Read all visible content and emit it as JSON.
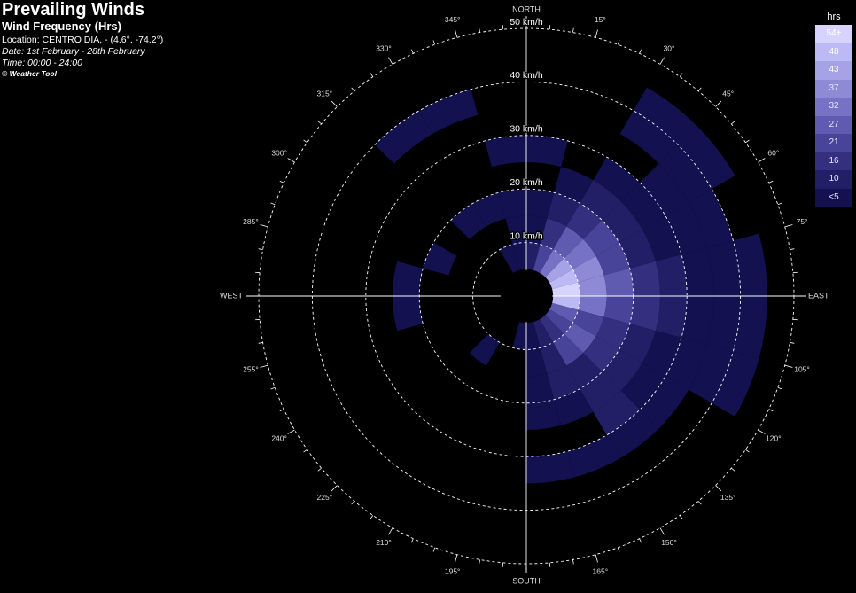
{
  "header": {
    "title": "Prevailing Winds",
    "subtitle": "Wind Frequency (Hrs)",
    "location": "Location: CENTRO DIA, - (4.6°, -74.2°)",
    "date": "Date: 1st February - 28th February",
    "time": "Time: 00:00 - 24:00",
    "copyright": "© Weather Tool"
  },
  "legend": {
    "title": "hrs",
    "items": [
      {
        "label": "54+",
        "color": "#d6d4ff"
      },
      {
        "label": "48",
        "color": "#bcb9f4"
      },
      {
        "label": "43",
        "color": "#a5a2e6"
      },
      {
        "label": "37",
        "color": "#8e8ad6"
      },
      {
        "label": "32",
        "color": "#7672c6"
      },
      {
        "label": "27",
        "color": "#5f5bb1"
      },
      {
        "label": "21",
        "color": "#48449a"
      },
      {
        "label": "16",
        "color": "#34307f"
      },
      {
        "label": "10",
        "color": "#221f66"
      },
      {
        "label": "<5",
        "color": "#131150"
      }
    ]
  },
  "chart_data": {
    "type": "polar_heatmap",
    "title": "Prevailing Winds",
    "subtitle": "Wind Frequency (Hrs)",
    "units": "km/h",
    "max_speed": 50,
    "rings": [
      {
        "value": 10,
        "label": "10 km/h"
      },
      {
        "value": 20,
        "label": "20 km/h"
      },
      {
        "value": 30,
        "label": "30 km/h"
      },
      {
        "value": 40,
        "label": "40 km/h"
      },
      {
        "value": 50,
        "label": "50 km/h"
      }
    ],
    "compass": [
      {
        "angle": 0,
        "label": "NORTH"
      },
      {
        "angle": 90,
        "label": "EAST"
      },
      {
        "angle": 180,
        "label": "SOUTH"
      },
      {
        "angle": 270,
        "label": "WEST"
      }
    ],
    "angle_labels": [
      {
        "angle": 15,
        "label": "15°"
      },
      {
        "angle": 30,
        "label": "30°"
      },
      {
        "angle": 45,
        "label": "45°"
      },
      {
        "angle": 60,
        "label": "60°"
      },
      {
        "angle": 75,
        "label": "75°"
      },
      {
        "angle": 105,
        "label": "105°"
      },
      {
        "angle": 120,
        "label": "120°"
      },
      {
        "angle": 135,
        "label": "135°"
      },
      {
        "angle": 150,
        "label": "150°"
      },
      {
        "angle": 165,
        "label": "165°"
      },
      {
        "angle": 195,
        "label": "195°"
      },
      {
        "angle": 210,
        "label": "210°"
      },
      {
        "angle": 225,
        "label": "225°"
      },
      {
        "angle": 240,
        "label": "240°"
      },
      {
        "angle": 255,
        "label": "255°"
      },
      {
        "angle": 285,
        "label": "285°"
      },
      {
        "angle": 300,
        "label": "300°"
      },
      {
        "angle": 315,
        "label": "315°"
      },
      {
        "angle": 330,
        "label": "330°"
      },
      {
        "angle": 345,
        "label": "345°"
      }
    ],
    "cells": [
      {
        "dir_from": 0,
        "dir_to": 15,
        "speed_from": 5,
        "speed_to": 10,
        "hours": 10
      },
      {
        "dir_from": 0,
        "dir_to": 15,
        "speed_from": 10,
        "speed_to": 15,
        "hours": 6
      },
      {
        "dir_from": 0,
        "dir_to": 15,
        "speed_from": 15,
        "speed_to": 20,
        "hours": 4
      },
      {
        "dir_from": 0,
        "dir_to": 15,
        "speed_from": 25,
        "speed_to": 30,
        "hours": 4
      },
      {
        "dir_from": 345,
        "dir_to": 360,
        "speed_from": 5,
        "speed_to": 10,
        "hours": 6
      },
      {
        "dir_from": 345,
        "dir_to": 360,
        "speed_from": 10,
        "speed_to": 15,
        "hours": 5
      },
      {
        "dir_from": 345,
        "dir_to": 360,
        "speed_from": 15,
        "speed_to": 20,
        "hours": 4
      },
      {
        "dir_from": 345,
        "dir_to": 360,
        "speed_from": 25,
        "speed_to": 30,
        "hours": 4
      },
      {
        "dir_from": 330,
        "dir_to": 345,
        "speed_from": 5,
        "speed_to": 10,
        "hours": 4
      },
      {
        "dir_from": 330,
        "dir_to": 345,
        "speed_from": 15,
        "speed_to": 20,
        "hours": 4
      },
      {
        "dir_from": 330,
        "dir_to": 345,
        "speed_from": 35,
        "speed_to": 40,
        "hours": 3
      },
      {
        "dir_from": 315,
        "dir_to": 330,
        "speed_from": 15,
        "speed_to": 20,
        "hours": 4
      },
      {
        "dir_from": 315,
        "dir_to": 330,
        "speed_from": 35,
        "speed_to": 40,
        "hours": 3
      },
      {
        "dir_from": 15,
        "dir_to": 30,
        "speed_from": 5,
        "speed_to": 10,
        "hours": 24
      },
      {
        "dir_from": 15,
        "dir_to": 30,
        "speed_from": 10,
        "speed_to": 15,
        "hours": 16
      },
      {
        "dir_from": 15,
        "dir_to": 30,
        "speed_from": 15,
        "speed_to": 20,
        "hours": 10
      },
      {
        "dir_from": 15,
        "dir_to": 30,
        "speed_from": 20,
        "speed_to": 25,
        "hours": 6
      },
      {
        "dir_from": 30,
        "dir_to": 45,
        "speed_from": 5,
        "speed_to": 10,
        "hours": 36
      },
      {
        "dir_from": 30,
        "dir_to": 45,
        "speed_from": 10,
        "speed_to": 15,
        "hours": 30
      },
      {
        "dir_from": 30,
        "dir_to": 45,
        "speed_from": 15,
        "speed_to": 20,
        "hours": 20
      },
      {
        "dir_from": 30,
        "dir_to": 45,
        "speed_from": 20,
        "speed_to": 25,
        "hours": 10
      },
      {
        "dir_from": 30,
        "dir_to": 45,
        "speed_from": 25,
        "speed_to": 30,
        "hours": 4
      },
      {
        "dir_from": 30,
        "dir_to": 45,
        "speed_from": 35,
        "speed_to": 40,
        "hours": 3
      },
      {
        "dir_from": 30,
        "dir_to": 45,
        "speed_from": 40,
        "speed_to": 45,
        "hours": 3
      },
      {
        "dir_from": 45,
        "dir_to": 60,
        "speed_from": 5,
        "speed_to": 10,
        "hours": 44
      },
      {
        "dir_from": 45,
        "dir_to": 60,
        "speed_from": 10,
        "speed_to": 15,
        "hours": 34
      },
      {
        "dir_from": 45,
        "dir_to": 60,
        "speed_from": 15,
        "speed_to": 20,
        "hours": 24
      },
      {
        "dir_from": 45,
        "dir_to": 60,
        "speed_from": 20,
        "speed_to": 25,
        "hours": 14
      },
      {
        "dir_from": 45,
        "dir_to": 60,
        "speed_from": 25,
        "speed_to": 30,
        "hours": 8
      },
      {
        "dir_from": 45,
        "dir_to": 60,
        "speed_from": 30,
        "speed_to": 35,
        "hours": 5
      },
      {
        "dir_from": 45,
        "dir_to": 60,
        "speed_from": 35,
        "speed_to": 40,
        "hours": 3
      },
      {
        "dir_from": 45,
        "dir_to": 60,
        "speed_from": 40,
        "speed_to": 45,
        "hours": 3
      },
      {
        "dir_from": 60,
        "dir_to": 75,
        "speed_from": 5,
        "speed_to": 10,
        "hours": 50
      },
      {
        "dir_from": 60,
        "dir_to": 75,
        "speed_from": 10,
        "speed_to": 15,
        "hours": 38
      },
      {
        "dir_from": 60,
        "dir_to": 75,
        "speed_from": 15,
        "speed_to": 20,
        "hours": 26
      },
      {
        "dir_from": 60,
        "dir_to": 75,
        "speed_from": 20,
        "speed_to": 25,
        "hours": 14
      },
      {
        "dir_from": 60,
        "dir_to": 75,
        "speed_from": 25,
        "speed_to": 30,
        "hours": 8
      },
      {
        "dir_from": 60,
        "dir_to": 75,
        "speed_from": 30,
        "speed_to": 35,
        "hours": 5
      },
      {
        "dir_from": 60,
        "dir_to": 75,
        "speed_from": 35,
        "speed_to": 40,
        "hours": 4
      },
      {
        "dir_from": 75,
        "dir_to": 90,
        "speed_from": 5,
        "speed_to": 10,
        "hours": 56
      },
      {
        "dir_from": 75,
        "dir_to": 90,
        "speed_from": 10,
        "speed_to": 15,
        "hours": 40
      },
      {
        "dir_from": 75,
        "dir_to": 90,
        "speed_from": 15,
        "speed_to": 20,
        "hours": 28
      },
      {
        "dir_from": 75,
        "dir_to": 90,
        "speed_from": 20,
        "speed_to": 25,
        "hours": 18
      },
      {
        "dir_from": 75,
        "dir_to": 90,
        "speed_from": 25,
        "speed_to": 30,
        "hours": 10
      },
      {
        "dir_from": 75,
        "dir_to": 90,
        "speed_from": 30,
        "speed_to": 35,
        "hours": 6
      },
      {
        "dir_from": 75,
        "dir_to": 90,
        "speed_from": 35,
        "speed_to": 40,
        "hours": 4
      },
      {
        "dir_from": 75,
        "dir_to": 90,
        "speed_from": 40,
        "speed_to": 45,
        "hours": 3
      },
      {
        "dir_from": 90,
        "dir_to": 105,
        "speed_from": 5,
        "speed_to": 10,
        "hours": 48
      },
      {
        "dir_from": 90,
        "dir_to": 105,
        "speed_from": 10,
        "speed_to": 15,
        "hours": 32
      },
      {
        "dir_from": 90,
        "dir_to": 105,
        "speed_from": 15,
        "speed_to": 20,
        "hours": 24
      },
      {
        "dir_from": 90,
        "dir_to": 105,
        "speed_from": 20,
        "speed_to": 25,
        "hours": 16
      },
      {
        "dir_from": 90,
        "dir_to": 105,
        "speed_from": 25,
        "speed_to": 30,
        "hours": 10
      },
      {
        "dir_from": 90,
        "dir_to": 105,
        "speed_from": 30,
        "speed_to": 35,
        "hours": 6
      },
      {
        "dir_from": 90,
        "dir_to": 105,
        "speed_from": 35,
        "speed_to": 40,
        "hours": 4
      },
      {
        "dir_from": 90,
        "dir_to": 105,
        "speed_from": 40,
        "speed_to": 45,
        "hours": 3
      },
      {
        "dir_from": 105,
        "dir_to": 120,
        "speed_from": 5,
        "speed_to": 10,
        "hours": 30
      },
      {
        "dir_from": 105,
        "dir_to": 120,
        "speed_from": 10,
        "speed_to": 15,
        "hours": 26
      },
      {
        "dir_from": 105,
        "dir_to": 120,
        "speed_from": 15,
        "speed_to": 20,
        "hours": 20
      },
      {
        "dir_from": 105,
        "dir_to": 120,
        "speed_from": 20,
        "speed_to": 25,
        "hours": 14
      },
      {
        "dir_from": 105,
        "dir_to": 120,
        "speed_from": 25,
        "speed_to": 30,
        "hours": 8
      },
      {
        "dir_from": 105,
        "dir_to": 120,
        "speed_from": 30,
        "speed_to": 35,
        "hours": 5
      },
      {
        "dir_from": 105,
        "dir_to": 120,
        "speed_from": 35,
        "speed_to": 40,
        "hours": 4
      },
      {
        "dir_from": 105,
        "dir_to": 120,
        "speed_from": 40,
        "speed_to": 45,
        "hours": 3
      },
      {
        "dir_from": 120,
        "dir_to": 135,
        "speed_from": 5,
        "speed_to": 10,
        "hours": 22
      },
      {
        "dir_from": 120,
        "dir_to": 135,
        "speed_from": 10,
        "speed_to": 15,
        "hours": 28
      },
      {
        "dir_from": 120,
        "dir_to": 135,
        "speed_from": 15,
        "speed_to": 20,
        "hours": 16
      },
      {
        "dir_from": 120,
        "dir_to": 135,
        "speed_from": 20,
        "speed_to": 25,
        "hours": 10
      },
      {
        "dir_from": 120,
        "dir_to": 135,
        "speed_from": 25,
        "speed_to": 30,
        "hours": 6
      },
      {
        "dir_from": 120,
        "dir_to": 135,
        "speed_from": 30,
        "speed_to": 35,
        "hours": 4
      },
      {
        "dir_from": 135,
        "dir_to": 150,
        "speed_from": 5,
        "speed_to": 10,
        "hours": 16
      },
      {
        "dir_from": 135,
        "dir_to": 150,
        "speed_from": 10,
        "speed_to": 15,
        "hours": 24
      },
      {
        "dir_from": 135,
        "dir_to": 150,
        "speed_from": 15,
        "speed_to": 20,
        "hours": 14
      },
      {
        "dir_from": 135,
        "dir_to": 150,
        "speed_from": 20,
        "speed_to": 25,
        "hours": 12
      },
      {
        "dir_from": 135,
        "dir_to": 150,
        "speed_from": 25,
        "speed_to": 30,
        "hours": 10
      },
      {
        "dir_from": 135,
        "dir_to": 150,
        "speed_from": 30,
        "speed_to": 35,
        "hours": 4
      },
      {
        "dir_from": 150,
        "dir_to": 165,
        "speed_from": 5,
        "speed_to": 10,
        "hours": 10
      },
      {
        "dir_from": 150,
        "dir_to": 165,
        "speed_from": 10,
        "speed_to": 15,
        "hours": 12
      },
      {
        "dir_from": 150,
        "dir_to": 165,
        "speed_from": 15,
        "speed_to": 20,
        "hours": 10
      },
      {
        "dir_from": 150,
        "dir_to": 165,
        "speed_from": 20,
        "speed_to": 25,
        "hours": 8
      },
      {
        "dir_from": 150,
        "dir_to": 165,
        "speed_from": 30,
        "speed_to": 35,
        "hours": 3
      },
      {
        "dir_from": 165,
        "dir_to": 180,
        "speed_from": 5,
        "speed_to": 10,
        "hours": 4
      },
      {
        "dir_from": 165,
        "dir_to": 180,
        "speed_from": 10,
        "speed_to": 15,
        "hours": 6
      },
      {
        "dir_from": 165,
        "dir_to": 180,
        "speed_from": 15,
        "speed_to": 20,
        "hours": 4
      },
      {
        "dir_from": 165,
        "dir_to": 180,
        "speed_from": 20,
        "speed_to": 25,
        "hours": 4
      },
      {
        "dir_from": 165,
        "dir_to": 180,
        "speed_from": 30,
        "speed_to": 35,
        "hours": 3
      },
      {
        "dir_from": 180,
        "dir_to": 195,
        "speed_from": 5,
        "speed_to": 10,
        "hours": 4
      },
      {
        "dir_from": 210,
        "dir_to": 225,
        "speed_from": 10,
        "speed_to": 15,
        "hours": 3
      },
      {
        "dir_from": 270,
        "dir_to": 285,
        "speed_from": 20,
        "speed_to": 25,
        "hours": 3
      },
      {
        "dir_from": 255,
        "dir_to": 270,
        "speed_from": 20,
        "speed_to": 25,
        "hours": 3
      },
      {
        "dir_from": 285,
        "dir_to": 300,
        "speed_from": 15,
        "speed_to": 20,
        "hours": 3
      }
    ]
  }
}
